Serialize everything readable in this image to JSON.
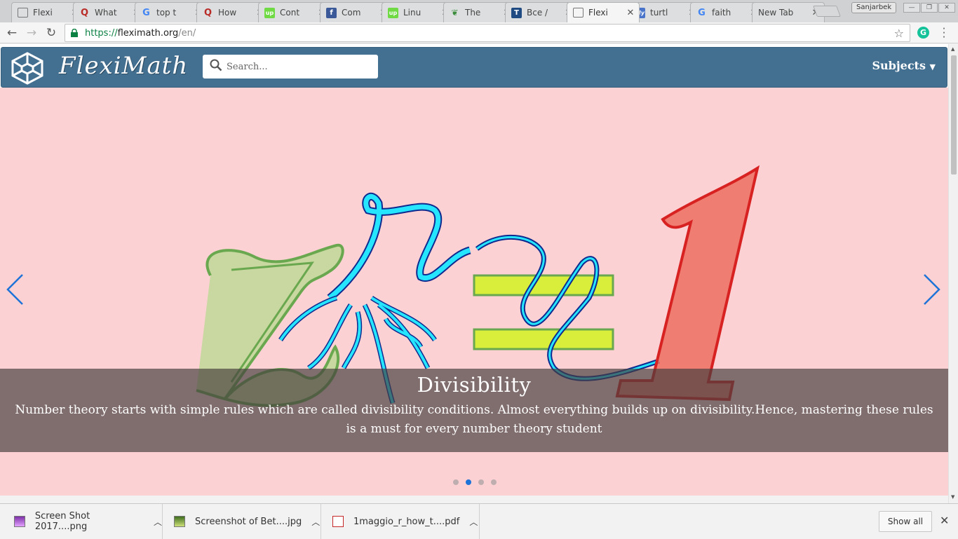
{
  "browser": {
    "tabs": [
      {
        "label": "Flexi",
        "icon": "page-icon",
        "active": false
      },
      {
        "label": "What",
        "icon": "quora-icon",
        "active": false
      },
      {
        "label": "top t",
        "icon": "google-icon",
        "active": false
      },
      {
        "label": "How",
        "icon": "quora-icon",
        "active": false
      },
      {
        "label": "Cont",
        "icon": "upwork-icon",
        "active": false
      },
      {
        "label": "Com",
        "icon": "facebook-icon",
        "active": false
      },
      {
        "label": "Linu",
        "icon": "upwork-icon",
        "active": false
      },
      {
        "label": "The",
        "icon": "leaf-icon",
        "active": false
      },
      {
        "label": "Bce /",
        "icon": "t-icon",
        "active": false
      },
      {
        "label": "Flexi",
        "icon": "page-icon",
        "active": true
      },
      {
        "label": "turtl",
        "icon": "my-icon",
        "active": false
      },
      {
        "label": "faith",
        "icon": "google-icon",
        "active": false
      },
      {
        "label": "New Tab",
        "icon": "",
        "active": false
      }
    ],
    "profile_name": "Sanjarbek",
    "url": {
      "scheme": "https://",
      "host": "fleximath.org",
      "path": "/en/"
    }
  },
  "site": {
    "logo_text": "FlexiMath",
    "search_placeholder": "Search...",
    "subjects_label": "Subjects",
    "colors": {
      "navbar": "#436f91",
      "hero_bg": "#fbd1d4",
      "accent": "#1e73d8"
    }
  },
  "carousel": {
    "slide_title": "Divisibility",
    "slide_text": "Number theory starts with simple rules which are called divisibility conditions. Almost everything builds up on divisibility.Hence, mastering these rules is a must for every number theory student",
    "slide_count": 4,
    "active_index": 1
  },
  "downloads": {
    "items": [
      {
        "name": "Screen Shot 2017....png",
        "icon": "image-file-icon"
      },
      {
        "name": "Screenshot of Bet....jpg",
        "icon": "image-file-icon"
      },
      {
        "name": "1maggio_r_how_t....pdf",
        "icon": "pdf-file-icon"
      }
    ],
    "show_all_label": "Show all"
  }
}
